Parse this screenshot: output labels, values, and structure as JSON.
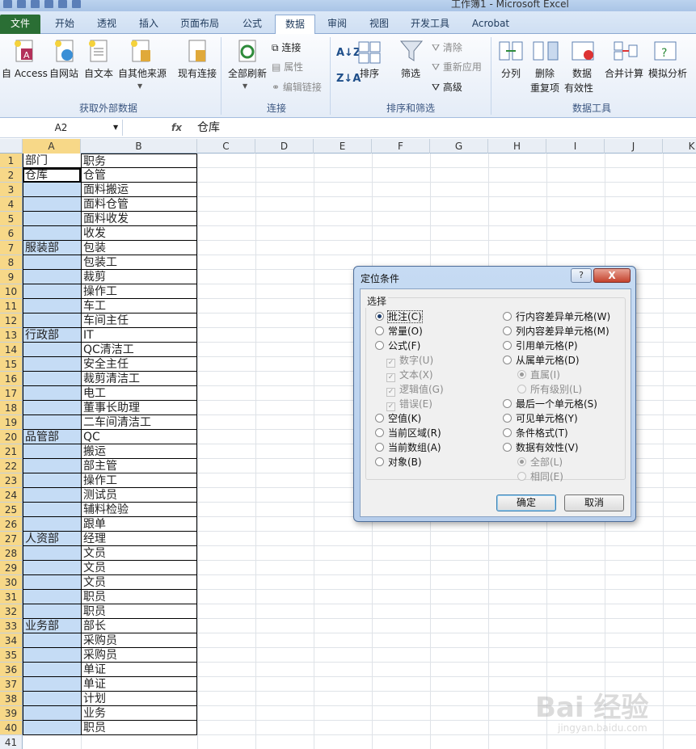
{
  "window": {
    "title": "工作簿1 - Microsoft Excel"
  },
  "tabs": [
    {
      "label": "文件"
    },
    {
      "label": "开始"
    },
    {
      "label": "透视"
    },
    {
      "label": "插入"
    },
    {
      "label": "页面布局"
    },
    {
      "label": "公式"
    },
    {
      "label": "数据"
    },
    {
      "label": "审阅"
    },
    {
      "label": "视图"
    },
    {
      "label": "开发工具"
    },
    {
      "label": "Acrobat"
    }
  ],
  "ribbon": {
    "group1": {
      "title": "获取外部数据",
      "buttons": [
        "自 Access",
        "自网站",
        "自文本",
        "自其他来源",
        "现有连接"
      ]
    },
    "group2": {
      "title": "连接",
      "big": "全部刷新",
      "small": [
        "连接",
        "属性",
        "编辑链接"
      ]
    },
    "group3": {
      "title": "排序和筛选",
      "big": [
        "排序",
        "筛选"
      ],
      "small": [
        "清除",
        "重新应用",
        "高级"
      ]
    },
    "group4": {
      "title": "数据工具",
      "buttons": [
        "分列",
        "删除",
        "重复项",
        "数据",
        "有效性",
        "合并计算",
        "模拟分析"
      ]
    }
  },
  "formula_bar": {
    "name_box": "A2",
    "fx": "fx",
    "content": "仓库"
  },
  "columns": [
    "A",
    "B",
    "C",
    "D",
    "E",
    "F",
    "G",
    "H",
    "I",
    "J",
    "K"
  ],
  "rows": [
    {
      "n": "1",
      "a": "部门",
      "b": "职务"
    },
    {
      "n": "2",
      "a": "仓库",
      "b": "仓管"
    },
    {
      "n": "3",
      "a": "",
      "b": "面料搬运"
    },
    {
      "n": "4",
      "a": "",
      "b": "面料仓管"
    },
    {
      "n": "5",
      "a": "",
      "b": "面料收发"
    },
    {
      "n": "6",
      "a": "",
      "b": "收发"
    },
    {
      "n": "7",
      "a": "服装部",
      "b": "包装"
    },
    {
      "n": "8",
      "a": "",
      "b": "包装工"
    },
    {
      "n": "9",
      "a": "",
      "b": "裁剪"
    },
    {
      "n": "10",
      "a": "",
      "b": "操作工"
    },
    {
      "n": "11",
      "a": "",
      "b": "车工"
    },
    {
      "n": "12",
      "a": "",
      "b": "车间主任"
    },
    {
      "n": "13",
      "a": "行政部",
      "b": "IT"
    },
    {
      "n": "14",
      "a": "",
      "b": "QC清洁工"
    },
    {
      "n": "15",
      "a": "",
      "b": "安全主任"
    },
    {
      "n": "16",
      "a": "",
      "b": "裁剪清洁工"
    },
    {
      "n": "17",
      "a": "",
      "b": "电工"
    },
    {
      "n": "18",
      "a": "",
      "b": "董事长助理"
    },
    {
      "n": "19",
      "a": "",
      "b": "二车间清洁工"
    },
    {
      "n": "20",
      "a": "品管部",
      "b": "QC"
    },
    {
      "n": "21",
      "a": "",
      "b": "搬运"
    },
    {
      "n": "22",
      "a": "",
      "b": "部主管"
    },
    {
      "n": "23",
      "a": "",
      "b": "操作工"
    },
    {
      "n": "24",
      "a": "",
      "b": "测试员"
    },
    {
      "n": "25",
      "a": "",
      "b": "辅料检验"
    },
    {
      "n": "26",
      "a": "",
      "b": "跟单"
    },
    {
      "n": "27",
      "a": "人资部",
      "b": "经理"
    },
    {
      "n": "28",
      "a": "",
      "b": "文员"
    },
    {
      "n": "29",
      "a": "",
      "b": "文员"
    },
    {
      "n": "30",
      "a": "",
      "b": "文员"
    },
    {
      "n": "31",
      "a": "",
      "b": "职员"
    },
    {
      "n": "32",
      "a": "",
      "b": "职员"
    },
    {
      "n": "33",
      "a": "业务部",
      "b": "部长"
    },
    {
      "n": "34",
      "a": "",
      "b": "采购员"
    },
    {
      "n": "35",
      "a": "",
      "b": "采购员"
    },
    {
      "n": "36",
      "a": "",
      "b": "单证"
    },
    {
      "n": "37",
      "a": "",
      "b": "单证"
    },
    {
      "n": "38",
      "a": "",
      "b": "计划"
    },
    {
      "n": "39",
      "a": "",
      "b": "业务"
    },
    {
      "n": "40",
      "a": "",
      "b": "职员"
    },
    {
      "n": "41",
      "a": "",
      "b": ""
    }
  ],
  "dialog": {
    "title": "定位条件",
    "help": "?",
    "close": "X",
    "group_label": "选择",
    "left_options": [
      "批注(C)",
      "常量(O)",
      "公式(F)",
      "数字(U)",
      "文本(X)",
      "逻辑值(G)",
      "错误(E)",
      "空值(K)",
      "当前区域(R)",
      "当前数组(A)",
      "对象(B)"
    ],
    "right_options": [
      "行内容差异单元格(W)",
      "列内容差异单元格(M)",
      "引用单元格(P)",
      "从属单元格(D)",
      "直属(I)",
      "所有级别(L)",
      "最后一个单元格(S)",
      "可见单元格(Y)",
      "条件格式(T)",
      "数据有效性(V)",
      "全部(L)",
      "相同(E)"
    ],
    "ok": "确定",
    "cancel": "取消"
  },
  "watermark": {
    "line1": "Bai 经验",
    "line2": "jingyan.baidu.com"
  }
}
